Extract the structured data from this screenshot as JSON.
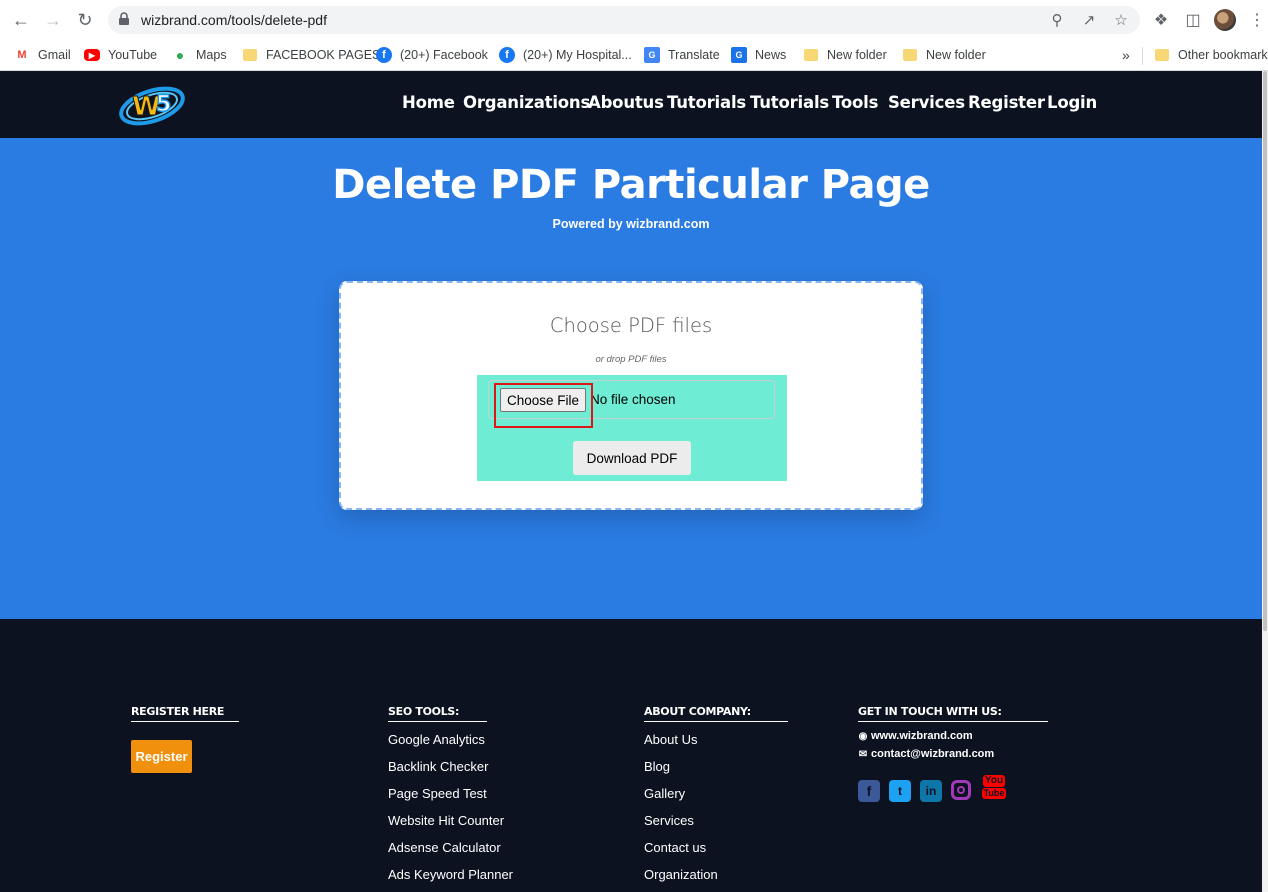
{
  "browser": {
    "url": "wizbrand.com/tools/delete-pdf",
    "bookmarks": [
      {
        "label": "Gmail",
        "icon": "gmail-icon"
      },
      {
        "label": "YouTube",
        "icon": "youtube-icon"
      },
      {
        "label": "Maps",
        "icon": "maps-icon"
      },
      {
        "label": "FACEBOOK PAGES",
        "icon": "folder-icon"
      },
      {
        "label": "(20+) Facebook",
        "icon": "facebook-icon"
      },
      {
        "label": "(20+) My Hospital...",
        "icon": "facebook-icon"
      },
      {
        "label": "Translate",
        "icon": "translate-icon"
      },
      {
        "label": "News",
        "icon": "news-icon"
      },
      {
        "label": "New folder",
        "icon": "folder-icon"
      },
      {
        "label": "New folder",
        "icon": "folder-icon"
      }
    ],
    "more_bookmarks": "»",
    "other_bookmarks": "Other bookmarks"
  },
  "header": {
    "nav": [
      "Home",
      "Organizations",
      "Aboutus",
      "Tutorials",
      "Tutorials",
      "Tools",
      "Services",
      "Register",
      "Login"
    ]
  },
  "hero": {
    "title": "Delete PDF Particular Page",
    "subtitle": "Powered by wizbrand.com"
  },
  "upload": {
    "title": "Choose PDF files",
    "subtitle": "or drop PDF files",
    "choose_button": "Choose File",
    "file_status": "No file chosen",
    "download_button": "Download PDF"
  },
  "footer": {
    "register": {
      "heading": "REGISTER HERE",
      "button": "Register"
    },
    "seo": {
      "heading": "SEO TOOLS:",
      "items": [
        "Google Analytics",
        "Backlink Checker",
        "Page Speed Test",
        "Website Hit Counter",
        "Adsense Calculator",
        "Ads Keyword Planner"
      ]
    },
    "about": {
      "heading": "ABOUT COMPANY:",
      "items": [
        "About Us",
        "Blog",
        "Gallery",
        "Services",
        "Contact us",
        "Organization"
      ]
    },
    "contact": {
      "heading": "GET IN TOUCH WITH US:",
      "website": "www.wizbrand.com",
      "email": "contact@wizbrand.com",
      "social": [
        "facebook-icon",
        "twitter-icon",
        "linkedin-icon",
        "instagram-icon",
        "youtube-icon"
      ]
    }
  },
  "colors": {
    "hero_bg": "#2a7be2",
    "header_bg": "#0c1220",
    "upload_zone": "#6eedd4",
    "register_button": "#f0900c",
    "highlight": "#e01616"
  }
}
